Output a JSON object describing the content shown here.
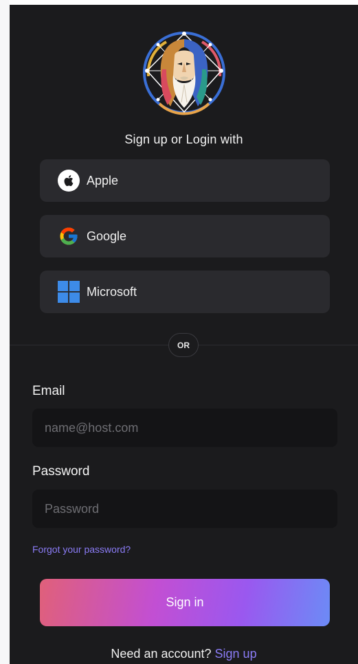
{
  "title": "Sign up or Login with",
  "providers": {
    "apple": {
      "label": "Apple",
      "icon": "apple-icon"
    },
    "google": {
      "label": "Google",
      "icon": "google-icon"
    },
    "microsoft": {
      "label": "Microsoft",
      "icon": "microsoft-icon"
    }
  },
  "divider": {
    "text": "OR"
  },
  "email": {
    "label": "Email",
    "placeholder": "name@host.com",
    "value": ""
  },
  "password": {
    "label": "Password",
    "placeholder": "Password",
    "value": ""
  },
  "forgot_password": "Forgot your password?",
  "sign_in_label": "Sign in",
  "signup": {
    "prompt": "Need an account?",
    "link": "Sign up"
  },
  "colors": {
    "panel_bg": "#1b1b1d",
    "button_bg": "#2a2a2e",
    "input_bg": "#141416",
    "link": "#8b7cf6",
    "gradient_start": "#e0607a",
    "gradient_end": "#6c8bf6"
  }
}
